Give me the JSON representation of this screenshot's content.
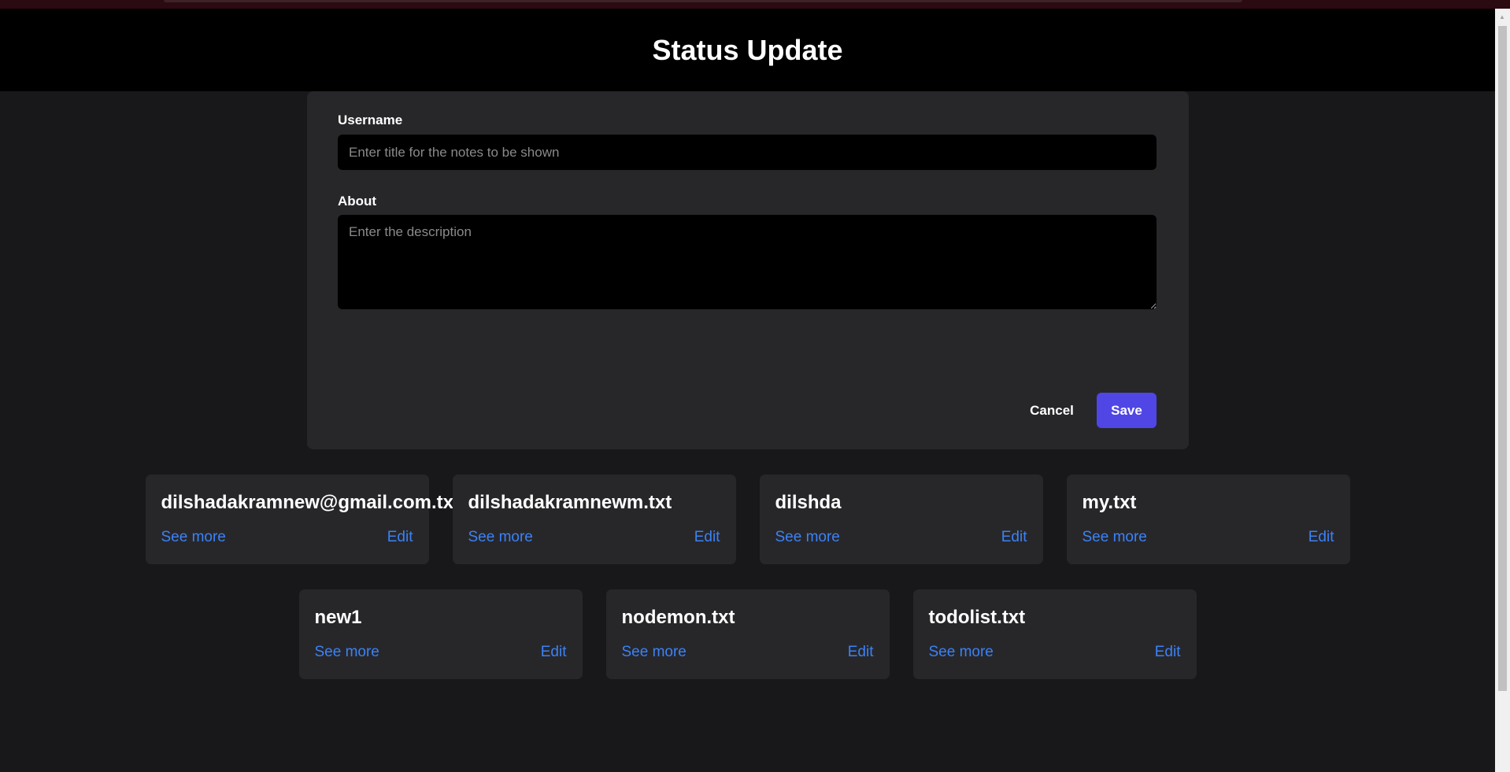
{
  "header": {
    "title": "Status Update"
  },
  "form": {
    "username_label": "Username",
    "username_placeholder": "Enter title for the notes to be shown",
    "username_value": "",
    "about_label": "About",
    "about_placeholder": "Enter the description",
    "about_value": "",
    "cancel_label": "Cancel",
    "save_label": "Save"
  },
  "notes": [
    {
      "title": "dilshadakramnew@gmail.com.txt",
      "see_more": "See more",
      "edit": "Edit"
    },
    {
      "title": "dilshadakramnewm.txt",
      "see_more": "See more",
      "edit": "Edit"
    },
    {
      "title": "dilshda",
      "see_more": "See more",
      "edit": "Edit"
    },
    {
      "title": "my.txt",
      "see_more": "See more",
      "edit": "Edit"
    },
    {
      "title": "new1",
      "see_more": "See more",
      "edit": "Edit"
    },
    {
      "title": "nodemon.txt",
      "see_more": "See more",
      "edit": "Edit"
    },
    {
      "title": "todolist.txt",
      "see_more": "See more",
      "edit": "Edit"
    }
  ],
  "colors": {
    "accent": "#4f46e5",
    "link": "#3b82f6",
    "card": "#27272a",
    "background": "#18181b"
  }
}
